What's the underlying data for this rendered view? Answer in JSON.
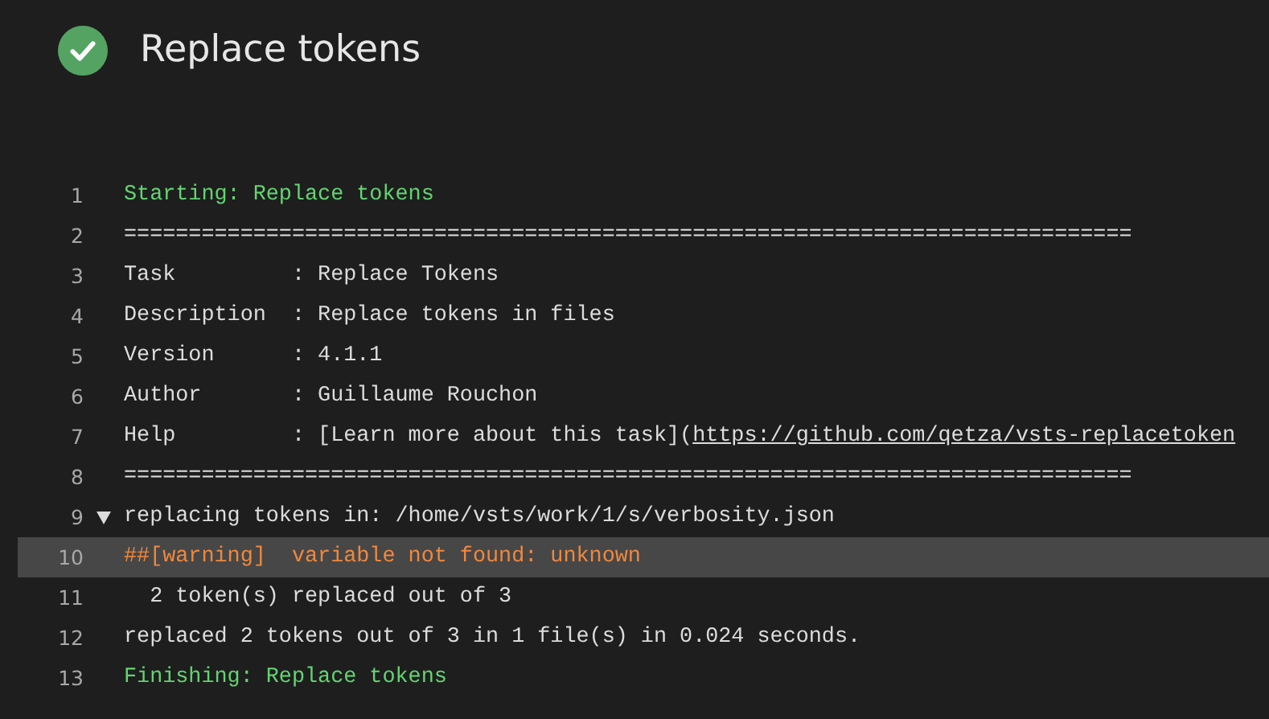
{
  "header": {
    "title": "Replace tokens",
    "kind": "success"
  },
  "lines": [
    {
      "number": "1",
      "kind": "section",
      "text": "Starting: Replace tokens",
      "selected": false
    },
    {
      "number": "2",
      "kind": "plain",
      "text": "==============================================================================",
      "selected": false
    },
    {
      "number": "3",
      "kind": "plain",
      "text": "Task         : Replace Tokens",
      "selected": false
    },
    {
      "number": "4",
      "kind": "plain",
      "text": "Description  : Replace tokens in files",
      "selected": false
    },
    {
      "number": "5",
      "kind": "plain",
      "text": "Version      : 4.1.1",
      "selected": false
    },
    {
      "number": "6",
      "kind": "plain",
      "text": "Author       : Guillaume Rouchon",
      "selected": false
    },
    {
      "number": "7",
      "kind": "plain",
      "text": "Help         : [Learn more about this task](",
      "link": "https://github.com/qetza/vsts-replacetoken",
      "selected": false
    },
    {
      "number": "8",
      "kind": "plain",
      "text": "==============================================================================",
      "selected": false
    },
    {
      "number": "9",
      "kind": "plain",
      "text": "replacing tokens in: /home/vsts/work/1/s/verbosity.json",
      "toggle": {
        "expanded": true
      },
      "selected": false
    },
    {
      "number": "10",
      "kind": "warning",
      "text": "##[warning]  variable not found: unknown",
      "selected": true
    },
    {
      "number": "11",
      "kind": "plain",
      "text": "  2 token(s) replaced out of 3",
      "selected": false
    },
    {
      "number": "12",
      "kind": "plain",
      "text": "replaced 2 tokens out of 3 in 1 file(s) in 0.024 seconds.",
      "selected": false
    },
    {
      "number": "13",
      "kind": "section",
      "text": "Finishing: Replace tokens",
      "selected": false
    }
  ]
}
